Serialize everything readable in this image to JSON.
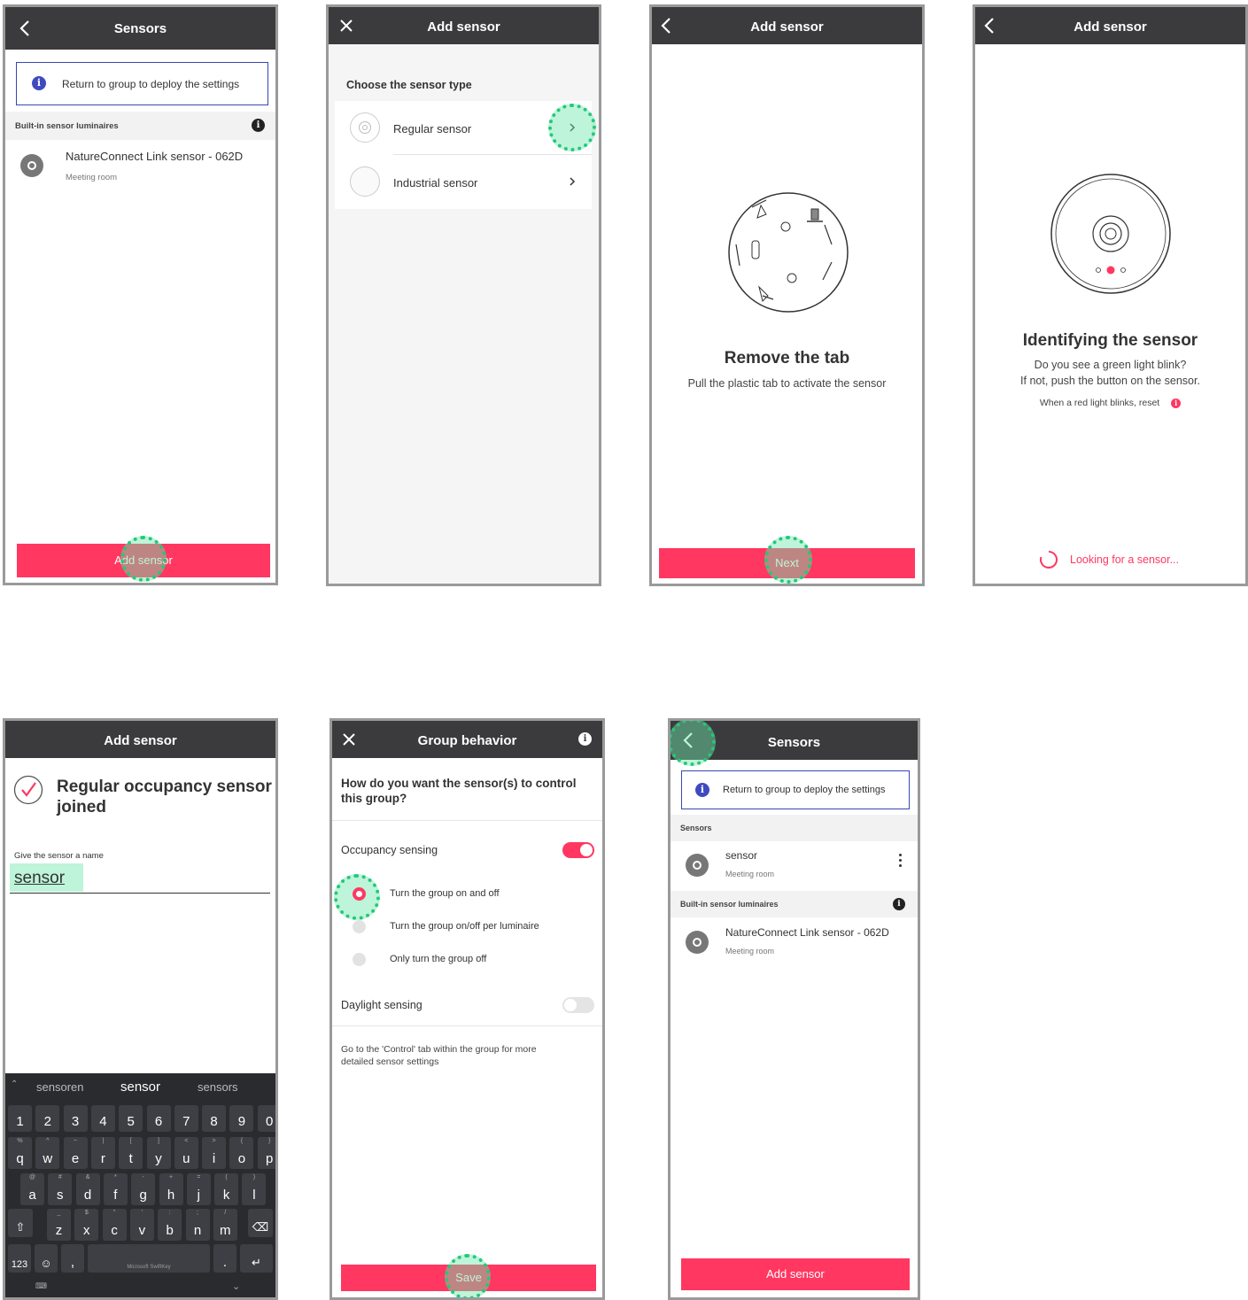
{
  "colors": {
    "header": "#3b3b3d",
    "accent": "#ff3761",
    "info": "#3f4ac0",
    "highlight": "#22c97a"
  },
  "s1": {
    "title": "Sensors",
    "back_icon": "chevron-left-icon",
    "info_text": "Return to group to deploy the settings",
    "section": "Built-in sensor luminaires",
    "item_name": "NatureConnect Link sensor - 062D",
    "item_room": "Meeting room",
    "button": "Add sensor"
  },
  "s2": {
    "title": "Add sensor",
    "close_icon": "close-icon",
    "heading": "Choose the sensor type",
    "options": [
      {
        "label": "Regular sensor"
      },
      {
        "label": "Industrial sensor"
      }
    ]
  },
  "s3": {
    "title": "Add sensor",
    "heading": "Remove the tab",
    "subtitle": "Pull the plastic tab to activate the sensor",
    "button": "Next"
  },
  "s4": {
    "title": "Add sensor",
    "heading": "Identifying the sensor",
    "line1": "Do you see a green light blink?",
    "line2": "If not, push the button on the sensor.",
    "line3": "When a red light blinks, reset",
    "status": "Looking for a sensor..."
  },
  "s5": {
    "title": "Add sensor",
    "joined_title": "Regular occupancy sensor joined",
    "field_label": "Give the sensor a name",
    "field_value": "sensor",
    "suggestions": [
      "sensoren",
      "sensor",
      "sensors"
    ],
    "num_row": [
      "1",
      "2",
      "3",
      "4",
      "5",
      "6",
      "7",
      "8",
      "9",
      "0"
    ],
    "row1": [
      "q",
      "w",
      "e",
      "r",
      "t",
      "y",
      "u",
      "i",
      "o",
      "p"
    ],
    "row1_sub": [
      "%",
      "^",
      "~",
      "|",
      "[",
      "]",
      "<",
      ">",
      "{",
      "}"
    ],
    "row2": [
      "a",
      "s",
      "d",
      "f",
      "g",
      "h",
      "j",
      "k",
      "l"
    ],
    "row2_sub": [
      "@",
      "#",
      "&",
      "*",
      "-",
      "+",
      "=",
      "(",
      ")"
    ],
    "row3": [
      "z",
      "x",
      "c",
      "v",
      "b",
      "n",
      "m"
    ],
    "row3_sub": [
      "_",
      "$",
      "\"",
      "'",
      ":",
      ";",
      "/"
    ],
    "key_123": "123",
    "comma": ",",
    "period": ".",
    "space_label": "Microsoft SwiftKey"
  },
  "s6": {
    "title": "Group behavior",
    "question": "How do you want the sensor(s) to control this group?",
    "occupancy_label": "Occupancy sensing",
    "occupancy_on": true,
    "radio_options": [
      "Turn the group on and off",
      "Turn the group on/off per luminaire",
      "Only turn the group off"
    ],
    "selected_option": 0,
    "daylight_label": "Daylight sensing",
    "daylight_on": false,
    "footer_note": "Go to the 'Control' tab within the group for more detailed sensor settings",
    "button": "Save"
  },
  "s7": {
    "title": "Sensors",
    "info_text": "Return to group to deploy the settings",
    "section_sensors": "Sensors",
    "sensor_name": "sensor",
    "sensor_room": "Meeting room",
    "section_builtin": "Built-in sensor luminaires",
    "item_name": "NatureConnect Link sensor - 062D",
    "item_room": "Meeting room",
    "button": "Add sensor"
  }
}
